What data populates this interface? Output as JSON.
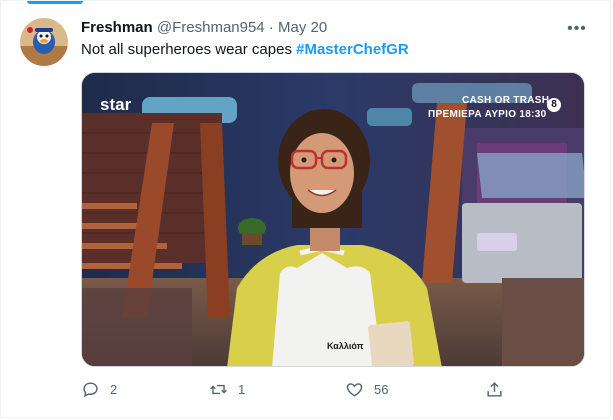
{
  "tweet": {
    "author_name": "Freshman",
    "author_handle": "@Freshman954",
    "separator": "·",
    "date": "May 20",
    "more_label": "•••",
    "text": "Not all superheroes wear capes ",
    "hashtag": "#MasterChefGR"
  },
  "media": {
    "channel_logo": "star",
    "promo_title": "CASH OR TRASH",
    "promo_subtitle": "ΠΡΕΜΙΕΡΑ ΑΥΡΙΟ 18:30",
    "rating_badge": "8",
    "apron_text": "Καλλιόπ"
  },
  "actions": {
    "reply_icon": "reply-icon",
    "reply_count": "2",
    "retweet_icon": "retweet-icon",
    "retweet_count": "1",
    "like_icon": "heart-icon",
    "like_count": "56",
    "share_icon": "share-icon"
  },
  "colors": {
    "accent": "#1d9bf0",
    "text_primary": "#0f1419",
    "text_secondary": "#536471",
    "border": "#eff3f4"
  }
}
